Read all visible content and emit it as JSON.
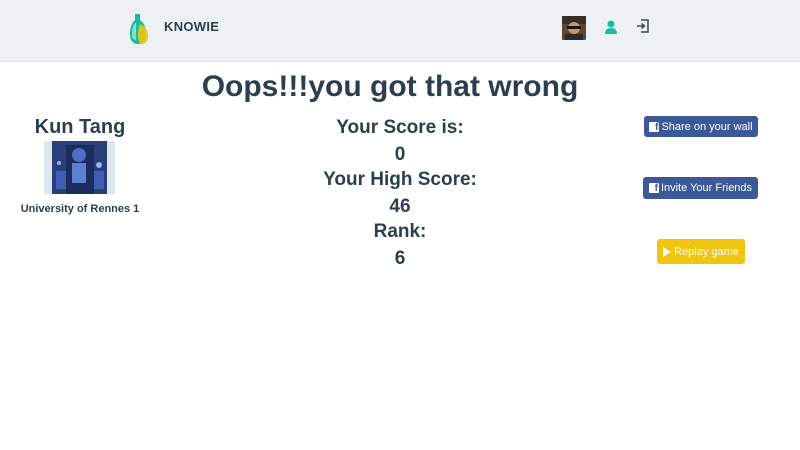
{
  "header": {
    "brand": "KNOWIE",
    "colors": {
      "background": "#eef1f4",
      "logo_green": "#1abc9c",
      "logo_yellow": "#f1c40f"
    }
  },
  "result": {
    "headline": "Oops!!!you got that wrong"
  },
  "player": {
    "name": "Kun Tang",
    "university": "University of Rennes 1"
  },
  "scores": {
    "score_label": "Your Score is:",
    "score_value": "0",
    "high_score_label": "Your High Score:",
    "high_score_value": "46",
    "rank_label": "Rank:",
    "rank_value": "6"
  },
  "actions": {
    "share_label": "Share on your wall",
    "invite_label": "Invite Your Friends",
    "replay_label": "Replay game",
    "colors": {
      "facebook": "#3b5998",
      "replay": "#f1c40f"
    }
  }
}
